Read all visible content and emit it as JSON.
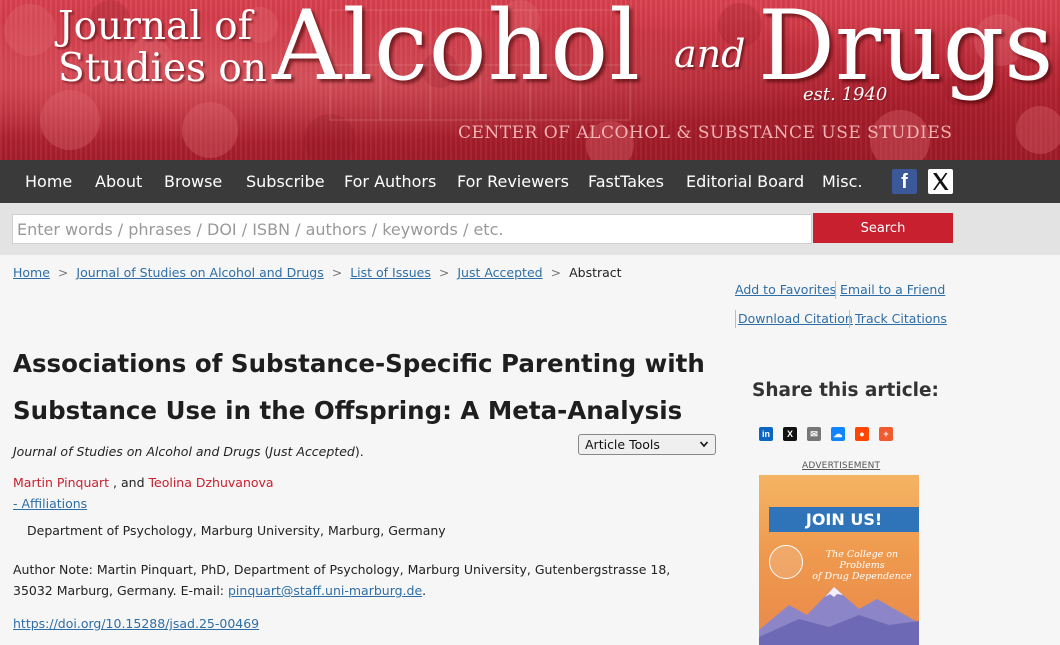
{
  "banner": {
    "journal_line1": "Journal of",
    "journal_line2": "Studies on",
    "word_alcohol": "Alcohol",
    "word_and": "and",
    "word_drugs": "Drugs",
    "est": "est. 1940",
    "center": "CENTER OF ALCOHOL & SUBSTANCE USE STUDIES"
  },
  "nav": {
    "items": [
      "Home",
      "About",
      "Browse",
      "Subscribe",
      "For Authors",
      "For Reviewers",
      "FastTakes",
      "Editorial Board",
      "Misc."
    ],
    "facebook_glyph": "f"
  },
  "search": {
    "placeholder": "Enter words / phrases / DOI / ISBN / authors / keywords / etc.",
    "button_label": "Search"
  },
  "breadcrumb": {
    "items": [
      "Home",
      "Journal of Studies on Alcohol and Drugs",
      "List of Issues",
      "Just Accepted"
    ],
    "current": "Abstract",
    "separator": ">"
  },
  "tools": {
    "add_favorites": "Add to Favorites",
    "email_friend": "Email to a Friend",
    "download_citation": "Download Citation",
    "track_citations": "Track Citations"
  },
  "article": {
    "title_line1": "Associations of Substance-Specific Parenting with",
    "title_line2": "Substance Use in the Offspring: A Meta-Analysis",
    "citation_journal": "Journal of Studies on Alcohol and Drugs",
    "citation_open": " (",
    "citation_issue": "Just Accepted",
    "citation_close": ").",
    "tools_select": "Article Tools",
    "author1": "Martin Pinquart",
    "author_join": " , and ",
    "author2": "Teolina Dzhuvanova",
    "affiliations_link": "- Affiliations",
    "affiliation": "Department of Psychology, Marburg University, Marburg, Germany",
    "author_note": "Author Note: Martin Pinquart, PhD, Department of Psychology, Marburg University, Gutenbergstrasse 18, 35032 Marburg, Germany. E-mail: ",
    "email": "pinquart@staff.uni-marburg.de",
    "note_end": ".",
    "doi": "https://doi.org/10.15288/jsad.25-00469"
  },
  "sidebar": {
    "share_title": "Share this article:",
    "share_icons": [
      {
        "name": "linkedin-icon",
        "glyph": "in",
        "color": "#0a66c2"
      },
      {
        "name": "x-icon",
        "glyph": "X",
        "color": "#111111"
      },
      {
        "name": "email-icon",
        "glyph": "✉",
        "color": "#777777"
      },
      {
        "name": "bluesky-icon",
        "glyph": "☁",
        "color": "#1185fe"
      },
      {
        "name": "reddit-icon",
        "glyph": "●",
        "color": "#ff4500"
      },
      {
        "name": "more-icon",
        "glyph": "+",
        "color": "#f15a2e"
      }
    ],
    "ad_label": "ADVERTISEMENT",
    "ad_join": "JOIN US!",
    "ad_org_line1": "The College on Problems",
    "ad_org_line2": "of Drug Dependence"
  },
  "colors": {
    "brand_red": "#c8202f",
    "nav_bg": "#3a3a3a",
    "link_blue": "#2e6ea6"
  }
}
